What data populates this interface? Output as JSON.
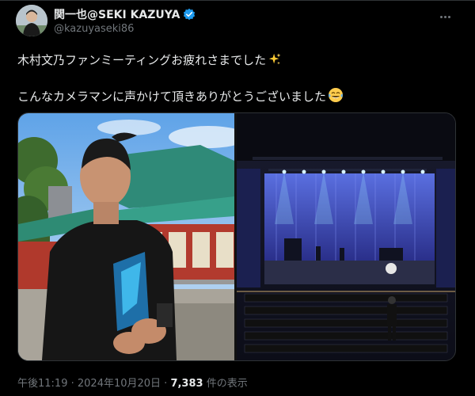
{
  "author": {
    "display_name": "関一也@SEKI KAZUYA",
    "handle": "@kazuyaseki86",
    "verified": true,
    "avatar": "profile-photo"
  },
  "tweet": {
    "line1": "木村文乃ファンミーティングお疲れさまでした",
    "line1_emoji": "sparkles-emoji",
    "line2": "こんなカメラマンに声かけて頂きありがとうございました",
    "line2_emoji": "tears-of-joy-emoji"
  },
  "media": [
    {
      "name": "man-at-shrine-photo"
    },
    {
      "name": "empty-concert-stage-photo"
    }
  ],
  "meta": {
    "time": "午後11:19",
    "separator": " · ",
    "date": "2024年10月20日",
    "separator2": " · ",
    "views": "7,383",
    "views_label": " 件の表示"
  },
  "colors": {
    "background": "#000000",
    "text": "#e7e9ea",
    "muted": "#71767b",
    "verified_badge": "#1d9bf0"
  }
}
